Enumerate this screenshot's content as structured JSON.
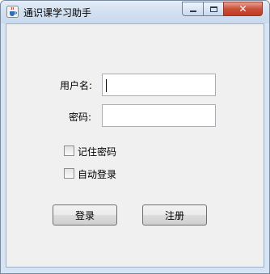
{
  "window": {
    "title": "通识课学习助手",
    "icons": {
      "app": "java-cup-icon",
      "minimize": "minimize-icon",
      "maximize": "maximize-icon",
      "close": "close-icon"
    },
    "colors": {
      "close_button": "#c9503a",
      "client_bg": "#f0f0f0"
    }
  },
  "form": {
    "username_label": "用户名:",
    "username_value": "",
    "password_label": "密码:",
    "password_value": "",
    "remember_password_label": "记住密码",
    "remember_password_checked": false,
    "auto_login_label": "自动登录",
    "auto_login_checked": false
  },
  "buttons": {
    "login": "登录",
    "register": "注册"
  }
}
